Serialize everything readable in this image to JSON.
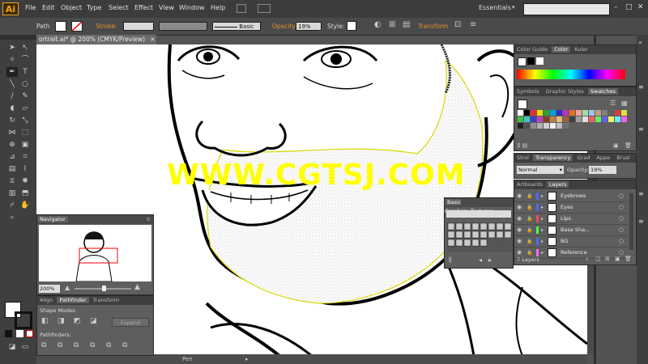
{
  "app": {
    "logo": "Ai"
  },
  "menu": [
    "File",
    "Edit",
    "Object",
    "Type",
    "Select",
    "Effect",
    "View",
    "Window",
    "Help"
  ],
  "workspace": "Essentials",
  "control": {
    "path_label": "Path",
    "stroke_label": "Stroke:",
    "brush_label": "Basic",
    "opacity_label": "Opacity:",
    "opacity_value": "19%",
    "style_label": "Style:",
    "transform_label": "Transform"
  },
  "document_tab": "ortrait.ai* @ 200% (CMYK/Preview)",
  "watermark": "WWW.CGTSJ.COM",
  "status": {
    "tool": "Pen"
  },
  "navigator": {
    "title": "Navigator",
    "zoom": "200%"
  },
  "pathfinder": {
    "tabs": [
      "Align",
      "Pathfinder",
      "Transform"
    ],
    "shape_modes": "Shape Modes:",
    "expand": "Expand",
    "pathfinders": "Pathfinders:"
  },
  "color_panel": {
    "tabs": [
      "Color Guide",
      "Color",
      "Kuler"
    ]
  },
  "swatches_panel": {
    "tabs": [
      "Symbols",
      "Graphic Styles",
      "Swatches"
    ]
  },
  "transparency_panel": {
    "tabs": [
      "Strol",
      "Transparency",
      "Grad",
      "Appe",
      "Brusl"
    ],
    "blend_mode": "Normal",
    "opacity_label": "Opacity:",
    "opacity_value": "19%"
  },
  "textures_panel": {
    "title": "Basic Graphics_Textures"
  },
  "layers_panel": {
    "tabs": [
      "Artboards",
      "Layers"
    ],
    "layers": [
      {
        "name": "Eyebrows",
        "color": "#4a6bff"
      },
      {
        "name": "Eyes",
        "color": "#4a6bff"
      },
      {
        "name": "Lips",
        "color": "#ff4a4a"
      },
      {
        "name": "Base Sha...",
        "color": "#4aff4a"
      },
      {
        "name": "BG",
        "color": "#4a6bff"
      },
      {
        "name": "Reference",
        "color": "#ff66ff"
      }
    ],
    "count": "7 Layers"
  }
}
